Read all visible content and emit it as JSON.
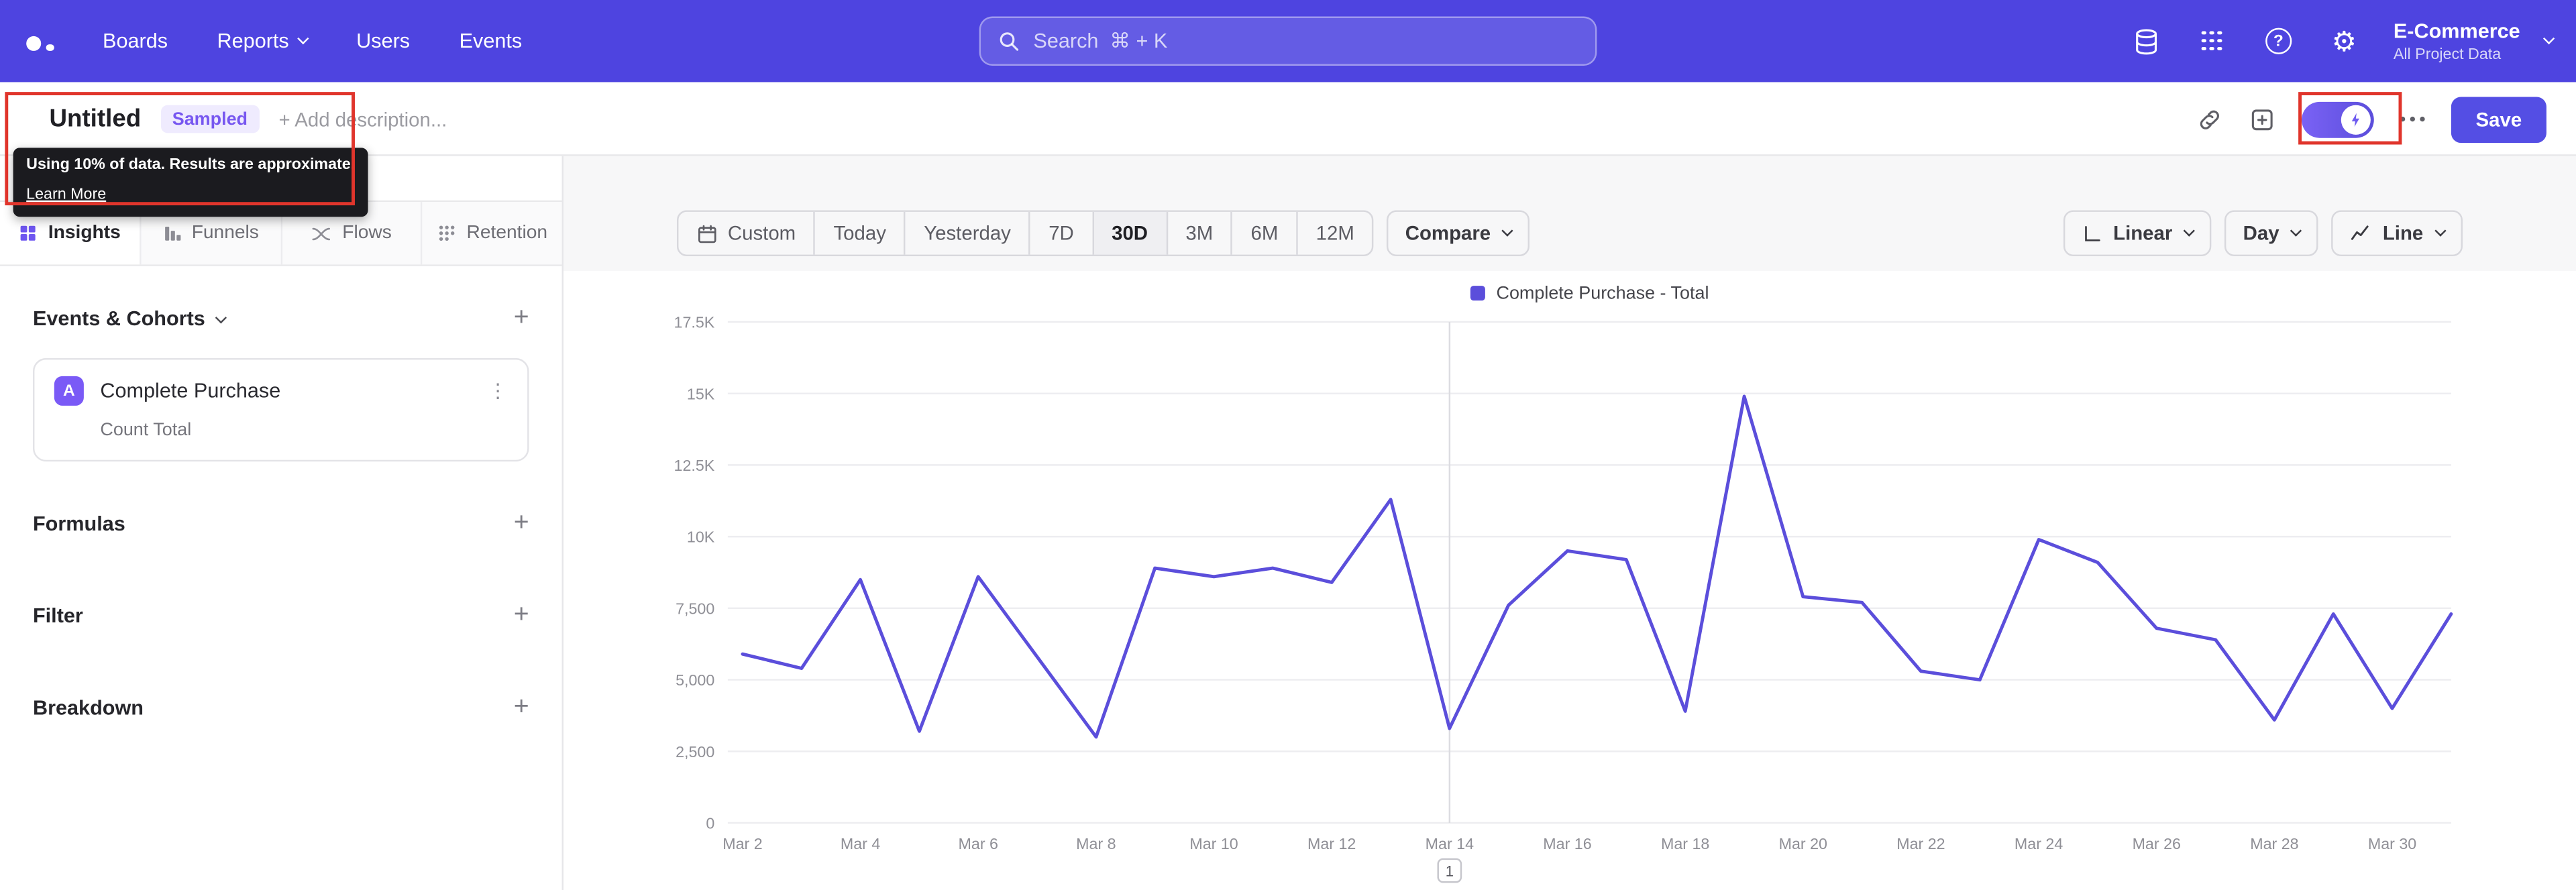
{
  "topnav": {
    "items": [
      {
        "label": "Boards",
        "chevron": false
      },
      {
        "label": "Reports",
        "chevron": true
      },
      {
        "label": "Users",
        "chevron": false
      },
      {
        "label": "Events",
        "chevron": false
      }
    ],
    "search_placeholder": "Search  ⌘ + K",
    "project": {
      "name": "E-Commerce",
      "scope": "All Project Data"
    }
  },
  "header": {
    "title": "Untitled",
    "sampled_badge": "Sampled",
    "add_description": "+ Add description...",
    "save_label": "Save"
  },
  "sampling_tooltip": {
    "message": "Using 10% of data. Results are approximate.",
    "link": "Learn More"
  },
  "sidebar": {
    "tabs": [
      {
        "label": "Insights",
        "active": true
      },
      {
        "label": "Funnels",
        "active": false
      },
      {
        "label": "Flows",
        "active": false
      },
      {
        "label": "Retention",
        "active": false
      }
    ],
    "events_header": "Events & Cohorts",
    "event_card": {
      "chip": "A",
      "name": "Complete Purchase",
      "metric": "Count Total"
    },
    "sections": [
      "Formulas",
      "Filter",
      "Breakdown"
    ]
  },
  "controls": {
    "date_ranges": [
      "Custom",
      "Today",
      "Yesterday",
      "7D",
      "30D",
      "3M",
      "6M",
      "12M"
    ],
    "active_range": "30D",
    "compare_label": "Compare",
    "view_buttons": {
      "linear": "Linear",
      "granularity": "Day",
      "chart_type": "Line"
    }
  },
  "colors": {
    "nav_purple": "#4E44E0",
    "accent": "#544EE4",
    "line": "#5B4EDB",
    "annotation_red": "#E0352C"
  },
  "chart_data": {
    "type": "line",
    "title": "",
    "legend": [
      "Complete Purchase - Total"
    ],
    "legend_position": "top",
    "grid": true,
    "x": [
      "Mar 2",
      "Mar 3",
      "Mar 4",
      "Mar 5",
      "Mar 6",
      "Mar 7",
      "Mar 8",
      "Mar 9",
      "Mar 10",
      "Mar 11",
      "Mar 12",
      "Mar 13",
      "Mar 14",
      "Mar 15",
      "Mar 16",
      "Mar 17",
      "Mar 18",
      "Mar 19",
      "Mar 20",
      "Mar 21",
      "Mar 22",
      "Mar 23",
      "Mar 24",
      "Mar 25",
      "Mar 26",
      "Mar 27",
      "Mar 28",
      "Mar 29",
      "Mar 30",
      "Mar 31"
    ],
    "x_tick_labels": [
      "Mar 2",
      "Mar 4",
      "Mar 6",
      "Mar 8",
      "Mar 10",
      "Mar 12",
      "Mar 14",
      "Mar 16",
      "Mar 18",
      "Mar 20",
      "Mar 22",
      "Mar 24",
      "Mar 26",
      "Mar 28",
      "Mar 30"
    ],
    "series": [
      {
        "name": "Complete Purchase - Total",
        "color": "#5B4EDB",
        "values": [
          5900,
          5400,
          8500,
          3200,
          8600,
          5800,
          3000,
          8900,
          8600,
          8900,
          8400,
          11300,
          3300,
          7600,
          9500,
          9200,
          3900,
          14900,
          7900,
          7700,
          5300,
          5000,
          9900,
          9100,
          6800,
          6400,
          3600,
          7300,
          4000,
          7300
        ]
      }
    ],
    "y_ticks": [
      0,
      2500,
      5000,
      7500,
      10000,
      12500,
      15000,
      17500
    ],
    "y_tick_labels": [
      "0",
      "2,500",
      "5,000",
      "7,500",
      "10K",
      "12.5K",
      "15K",
      "17.5K"
    ],
    "ylim": [
      0,
      17500
    ],
    "annotation": {
      "x": "Mar 14",
      "label": "1"
    }
  }
}
